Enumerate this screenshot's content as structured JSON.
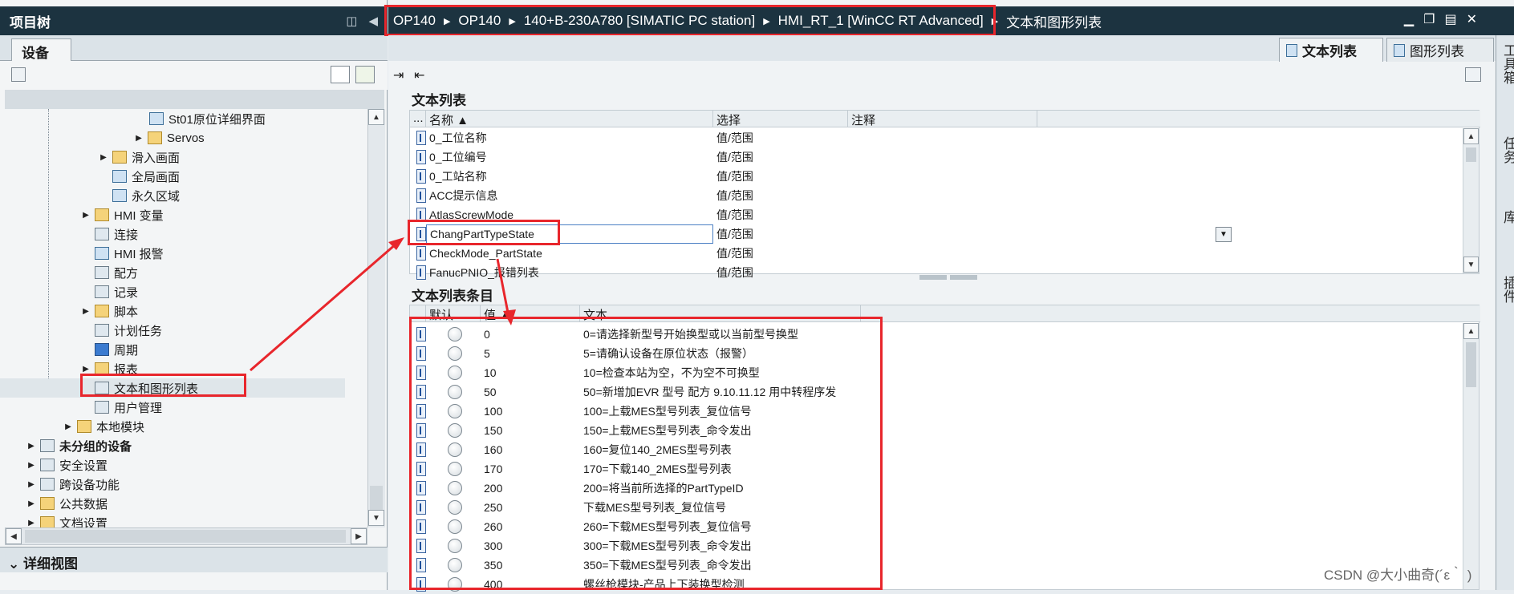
{
  "left": {
    "header": "项目树",
    "device_tab": "设备",
    "tree": [
      {
        "label": "St01原位详细界面",
        "icon": "screen-icon"
      },
      {
        "label": "Servos",
        "icon": "folder-icon"
      },
      {
        "label": "滑入画面",
        "icon": "folder-icon"
      },
      {
        "label": "全局画面",
        "icon": "screen-icon"
      },
      {
        "label": "永久区域",
        "icon": "screen-icon"
      },
      {
        "label": "HMI 变量",
        "icon": "folder-icon"
      },
      {
        "label": "连接",
        "icon": "connection-icon"
      },
      {
        "label": "HMI 报警",
        "icon": "alarm-icon"
      },
      {
        "label": "配方",
        "icon": "recipe-icon"
      },
      {
        "label": "记录",
        "icon": "log-icon"
      },
      {
        "label": "脚本",
        "icon": "folder-icon"
      },
      {
        "label": "计划任务",
        "icon": "task-icon"
      },
      {
        "label": "周期",
        "icon": "cycle-icon"
      },
      {
        "label": "报表",
        "icon": "folder-icon"
      },
      {
        "label": "文本和图形列表",
        "icon": "textlist-icon"
      },
      {
        "label": "用户管理",
        "icon": "user-icon"
      },
      {
        "label": "本地模块",
        "icon": "folder-icon"
      },
      {
        "label": "未分组的设备",
        "icon": "devices-icon"
      },
      {
        "label": "安全设置",
        "icon": "security-icon"
      },
      {
        "label": "跨设备功能",
        "icon": "cross-device-icon"
      },
      {
        "label": "公共数据",
        "icon": "folder-icon"
      },
      {
        "label": "文档设置",
        "icon": "folder-icon"
      }
    ],
    "detail_view": "详细视图"
  },
  "breadcrumb": [
    "OP140",
    "OP140",
    "140+B-230A780 [SIMATIC PC station]",
    "HMI_RT_1 [WinCC RT Advanced]",
    "文本和图形列表"
  ],
  "tabs": {
    "text_list": "文本列表",
    "graphic_list": "图形列表"
  },
  "text_lists": {
    "title": "文本列表",
    "columns": [
      "...",
      "名称 ▲",
      "选择",
      "注释"
    ],
    "rows": [
      {
        "name": "0_工位名称",
        "selection": "值/范围"
      },
      {
        "name": "0_工位编号",
        "selection": "值/范围"
      },
      {
        "name": "0_工站名称",
        "selection": "值/范围"
      },
      {
        "name": "ACC提示信息",
        "selection": "值/范围"
      },
      {
        "name": "AtlasScrewMode",
        "selection": "值/范围"
      },
      {
        "name": "ChangPartTypeState",
        "selection": "值/范围"
      },
      {
        "name": "CheckMode_PartState",
        "selection": "值/范围"
      },
      {
        "name": "FanucPNIO_报错列表",
        "selection": "值/范围"
      }
    ]
  },
  "entries": {
    "title": "文本列表条目",
    "columns": [
      "默认",
      "值 ▲",
      "文本"
    ],
    "rows": [
      {
        "value": "0",
        "text": "0=请选择新型号开始换型或以当前型号换型"
      },
      {
        "value": "5",
        "text": "5=请确认设备在原位状态（报警）"
      },
      {
        "value": "10",
        "text": "10=检查本站为空，不为空不可换型"
      },
      {
        "value": "50",
        "text": "50=新增加EVR 型号 配方 9.10.11.12 用中转程序发"
      },
      {
        "value": "100",
        "text": "100=上载MES型号列表_复位信号"
      },
      {
        "value": "150",
        "text": "150=上载MES型号列表_命令发出"
      },
      {
        "value": "160",
        "text": "160=复位140_2MES型号列表"
      },
      {
        "value": "170",
        "text": "170=下载140_2MES型号列表"
      },
      {
        "value": "200",
        "text": "200=将当前所选择的PartTypeID"
      },
      {
        "value": "250",
        "text": "下载MES型号列表_复位信号"
      },
      {
        "value": "260",
        "text": "260=下载MES型号列表_复位信号"
      },
      {
        "value": "300",
        "text": "300=下载MES型号列表_命令发出"
      },
      {
        "value": "350",
        "text": "350=下载MES型号列表_命令发出"
      },
      {
        "value": "400",
        "text": "螺丝枪模块-产品上下装换型检测"
      }
    ]
  },
  "side_tabs": [
    "工具箱",
    "任务",
    "库",
    "插件"
  ],
  "watermark": "CSDN @大小曲奇(´ε｀ )",
  "colors": {
    "header_bg": "#1c3340",
    "highlight": "#e8262c"
  }
}
